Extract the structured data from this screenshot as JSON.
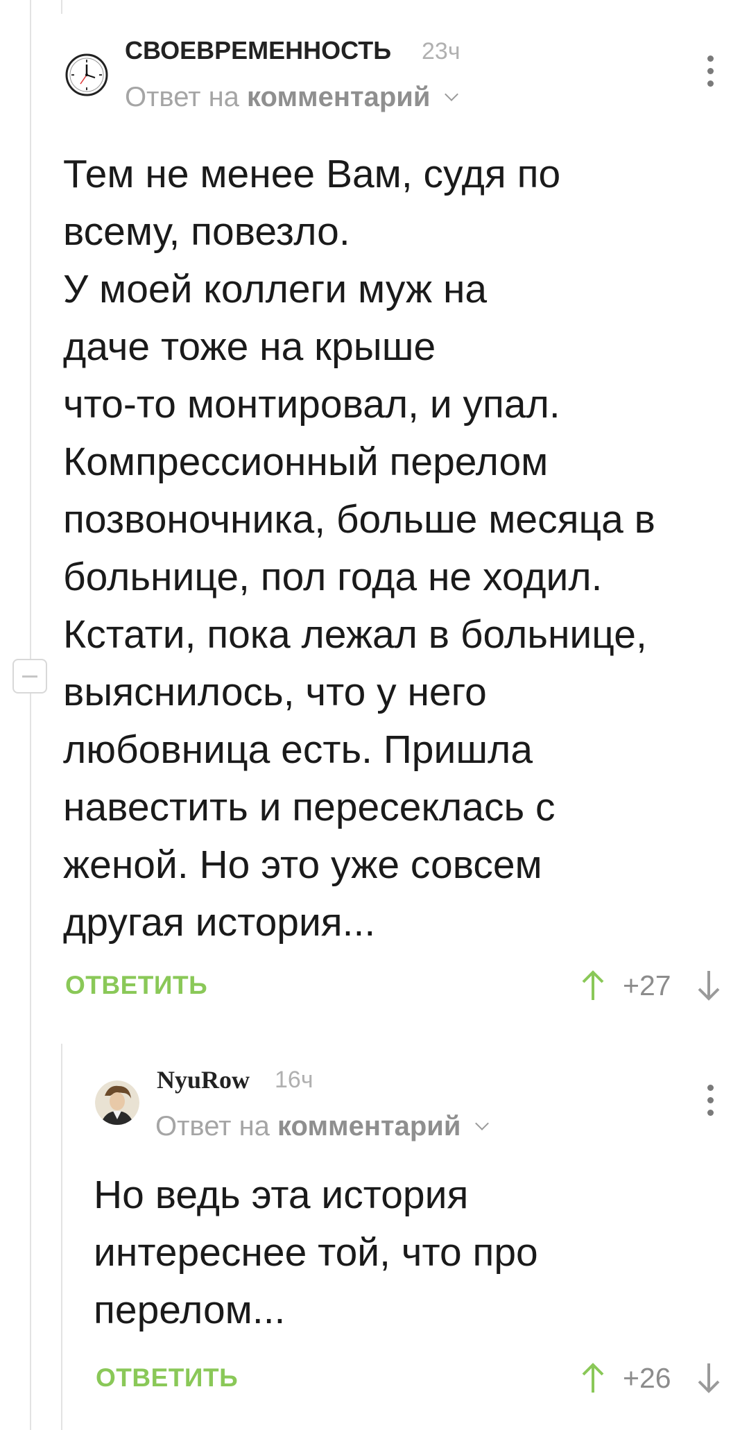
{
  "comments": [
    {
      "username": "СВОЕВРЕМЕННОСТЬ",
      "time": "23ч",
      "reply_to_prefix": "Ответ на",
      "reply_to_target": "комментарий",
      "avatar_icon": "clock-icon",
      "body": "Тем не менее Вам, судя по\nвсему, повезло.\nУ моей коллеги муж на\nдаче тоже на крыше\nчто-то монтировал, и упал.\nКомпрессионный перелом\nпозвоночника, больше месяца в\nбольнице, пол года не ходил.\nКстати, пока лежал в больнице,\nвыяснилось, что у него\nлюбовница есть. Пришла\nнавестить и пересеклась с\nженой. Но это уже совсем\nдругая история...",
      "reply_label": "ОТВЕТИТЬ",
      "rating": "+27"
    },
    {
      "username": "NyuRow",
      "time": "16ч",
      "reply_to_prefix": "Ответ на",
      "reply_to_target": "комментарий",
      "avatar_icon": "user-portrait-icon",
      "body": "Но ведь эта история\nинтереснее той, что про\nперелом...",
      "reply_label": "ОТВЕТИТЬ",
      "rating": "+26"
    }
  ],
  "colors": {
    "accent_green": "#8ac858",
    "muted_text": "#a5a5a5",
    "thread_line": "#e3e3e3"
  }
}
